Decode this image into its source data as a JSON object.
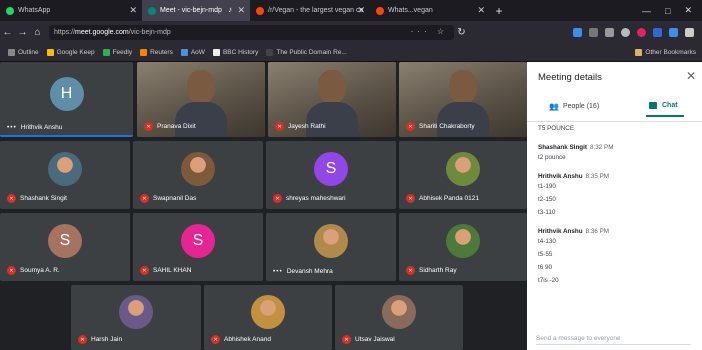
{
  "browser": {
    "tabs": [
      {
        "title": "WhatsApp",
        "color": "#25d366",
        "active": false
      },
      {
        "title": "Meet - vic-bejn-mdp",
        "color": "#00897b",
        "active": true
      },
      {
        "title": "/r/Vegan - the largest vegan co",
        "color": "#ff4500",
        "active": false
      },
      {
        "title": "Whats...vegan",
        "color": "#ff4500",
        "active": false
      }
    ],
    "url_prefix": "https://",
    "url_host": "meet.google.com",
    "url_path": "/vic-bejn-mdp",
    "bookmarks": [
      {
        "label": "Outline",
        "color": "#888888"
      },
      {
        "label": "Google Keep",
        "color": "#fbbc04"
      },
      {
        "label": "Feedly",
        "color": "#2bb24c"
      },
      {
        "label": "Reuters",
        "color": "#ff8000"
      },
      {
        "label": "AoW",
        "color": "#4a90e2"
      },
      {
        "label": "BBC History",
        "color": "#eeeeee"
      },
      {
        "label": "The Public Domain Re...",
        "color": "#444444"
      }
    ],
    "other_bookmarks": "Other Bookmarks"
  },
  "meet": {
    "participants": [
      {
        "name": "Hrithvik Anshu",
        "kind": "letter",
        "letter": "H",
        "color": "#5f8fa8",
        "muted": false,
        "speaking": true
      },
      {
        "name": "Pranava Dixit",
        "kind": "video",
        "muted": true
      },
      {
        "name": "Jayesh Rathi",
        "kind": "video",
        "muted": true
      },
      {
        "name": "Shariti Chakraborty",
        "kind": "video",
        "muted": true
      },
      {
        "name": "Shashank Singit",
        "kind": "photo",
        "color": "#4a6b7c",
        "muted": true
      },
      {
        "name": "Swapnanil Das",
        "kind": "photo",
        "color": "#7c5a3a",
        "muted": true
      },
      {
        "name": "shreyas maheshwari",
        "kind": "letter",
        "letter": "S",
        "color": "#9146e6",
        "muted": true
      },
      {
        "name": "Abhisek Panda 0121",
        "kind": "photo",
        "color": "#6f8a3d",
        "muted": true
      },
      {
        "name": "Soumya A. R.",
        "kind": "letter",
        "letter": "S",
        "color": "#a5735f",
        "muted": true
      },
      {
        "name": "SAHIL KHAN",
        "kind": "letter",
        "letter": "S",
        "color": "#e52592",
        "muted": true
      },
      {
        "name": "Devansh Mehra",
        "kind": "photo",
        "color": "#b08a4a",
        "muted": false
      },
      {
        "name": "Sidharth Ray",
        "kind": "photo",
        "color": "#4c7a3b",
        "muted": true
      },
      {
        "name": "Harsh Jain",
        "kind": "photo",
        "color": "#6a5a8a",
        "muted": true
      },
      {
        "name": "Abhishek Anand",
        "kind": "photo",
        "color": "#c0913f",
        "muted": true
      },
      {
        "name": "Utsav Jaiswal",
        "kind": "photo",
        "color": "#8a6a5a",
        "muted": true
      }
    ]
  },
  "panel": {
    "title": "Meeting details",
    "people_label": "People (16)",
    "chat_label": "Chat",
    "top_text": "T5 POUNCE",
    "messages": [
      {
        "sender": "Shashank Singit",
        "time": "8:32 PM",
        "lines": [
          "t2 pounce"
        ]
      },
      {
        "sender": "Hrithvik Anshu",
        "time": "8:35 PM",
        "lines": [
          "t1-190",
          "t2-150",
          "t3-110"
        ]
      },
      {
        "sender": "Hrithvik Anshu",
        "time": "8:36 PM",
        "lines": [
          "t4-130",
          "t5-55",
          "t6 90",
          "t7is -20"
        ]
      }
    ],
    "send_placeholder": "Send a message to everyone"
  }
}
